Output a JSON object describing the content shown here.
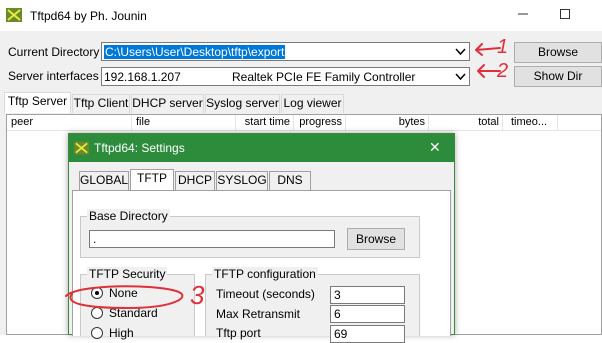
{
  "window": {
    "title": "Tftpd64 by Ph. Jounin",
    "min_icon": "minimize-icon",
    "max_icon": "maximize-icon"
  },
  "main": {
    "current_directory_label": "Current Directory",
    "current_directory_value": "C:\\Users\\User\\Desktop\\tftp\\export",
    "server_interfaces_label": "Server interfaces",
    "server_ip": "192.168.1.207",
    "server_adapter": "Realtek PCIe FE Family Controller",
    "browse_label": "Browse",
    "show_dir_label": "Show Dir",
    "tabs": [
      {
        "label": "Tftp Server"
      },
      {
        "label": "Tftp Client"
      },
      {
        "label": "DHCP server"
      },
      {
        "label": "Syslog server"
      },
      {
        "label": "Log viewer"
      }
    ],
    "columns": [
      {
        "label": "peer"
      },
      {
        "label": "file"
      },
      {
        "label": "start time"
      },
      {
        "label": "progress"
      },
      {
        "label": "bytes"
      },
      {
        "label": "total"
      },
      {
        "label": "timeo..."
      }
    ]
  },
  "settings": {
    "title": "Tftpd64: Settings",
    "tabs": [
      {
        "label": "GLOBAL"
      },
      {
        "label": "TFTP"
      },
      {
        "label": "DHCP"
      },
      {
        "label": "SYSLOG"
      },
      {
        "label": "DNS"
      }
    ],
    "base_directory_label": "Base Directory",
    "base_directory_value": ".",
    "browse_label": "Browse",
    "security_label": "TFTP Security",
    "security_options": [
      {
        "label": "None",
        "selected": true
      },
      {
        "label": "Standard",
        "selected": false
      },
      {
        "label": "High",
        "selected": false
      }
    ],
    "config_label": "TFTP configuration",
    "config_fields": [
      {
        "label": "Timeout (seconds)",
        "value": "3"
      },
      {
        "label": "Max Retransmit",
        "value": "6"
      },
      {
        "label": "Tftp port",
        "value": "69"
      }
    ]
  },
  "annotations": {
    "one": "1",
    "two": "2",
    "three": "3",
    "color": "#e0303a"
  },
  "colors": {
    "selection": "#0078d7",
    "dialog_title": "#2d8c3c"
  }
}
